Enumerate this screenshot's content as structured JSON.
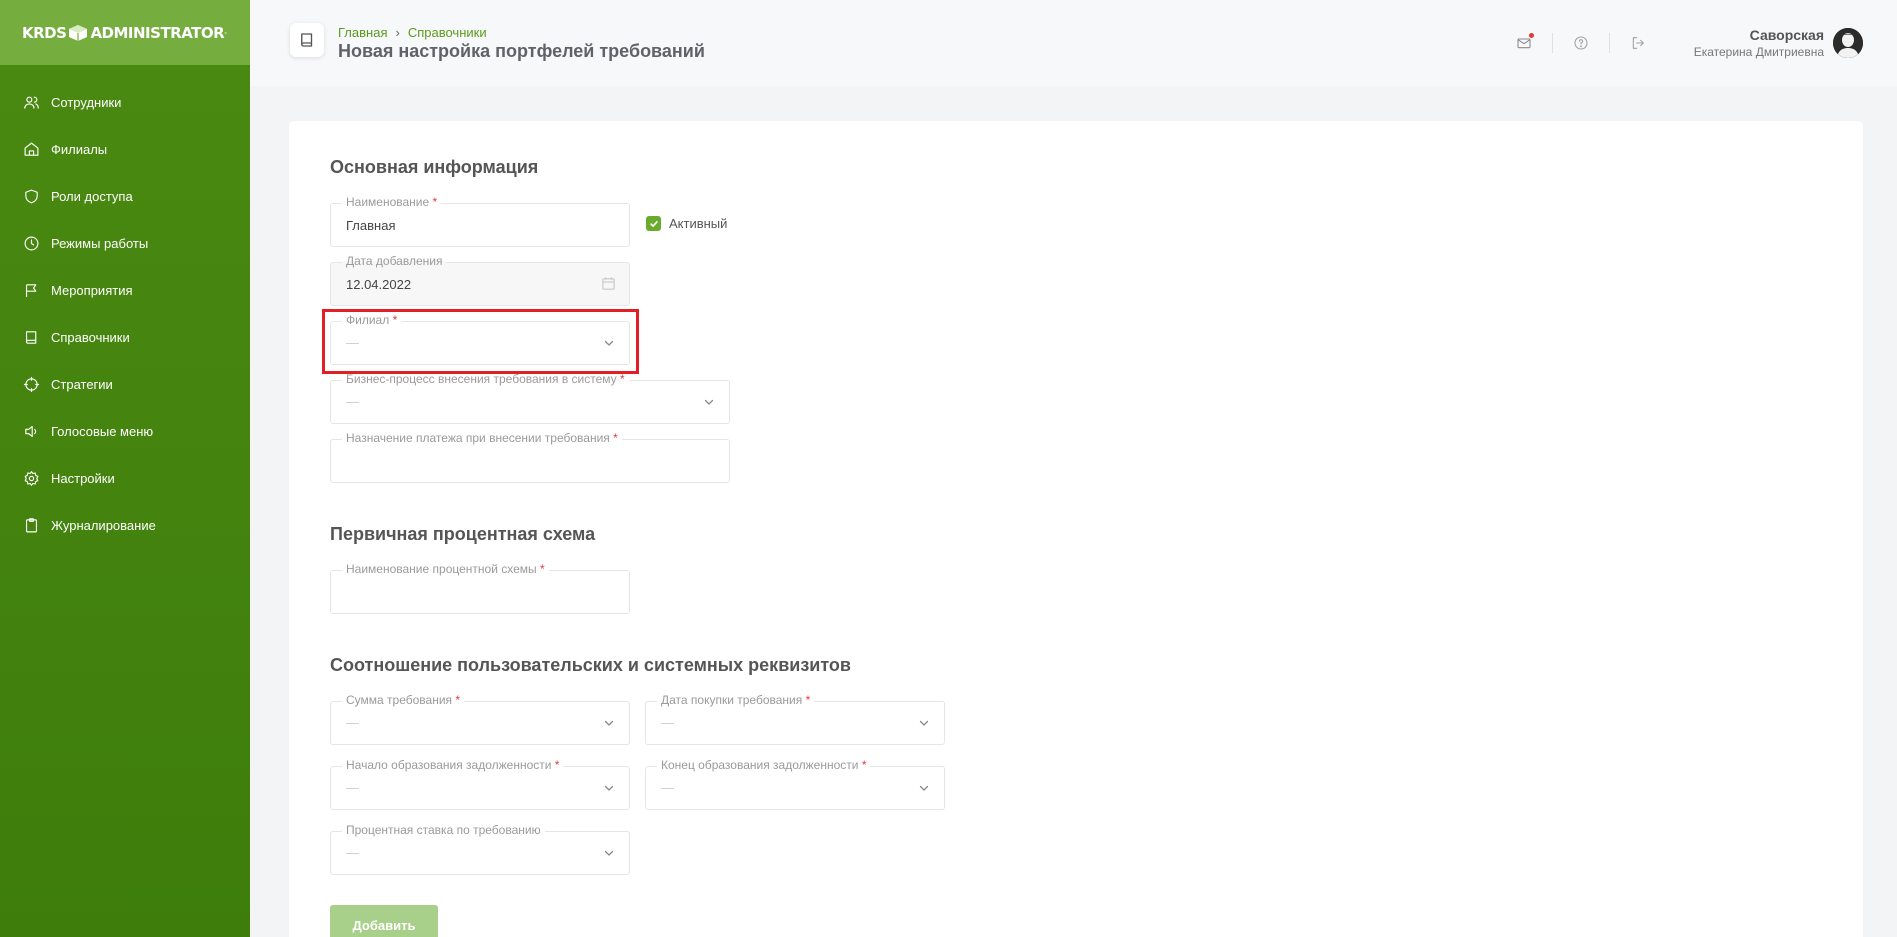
{
  "app": {
    "logo_left": "KRDS",
    "logo_right": "ADMINISTRATOR",
    "accent": "#4a8a12",
    "highlight": "#e31e24"
  },
  "sidebar": {
    "items": [
      {
        "label": "Сотрудники",
        "icon": "users-icon"
      },
      {
        "label": "Филиалы",
        "icon": "home-icon"
      },
      {
        "label": "Роли доступа",
        "icon": "shield-icon"
      },
      {
        "label": "Режимы работы",
        "icon": "clock-icon"
      },
      {
        "label": "Мероприятия",
        "icon": "flag-icon"
      },
      {
        "label": "Справочники",
        "icon": "book-icon"
      },
      {
        "label": "Стратегии",
        "icon": "crosshair-icon"
      },
      {
        "label": "Голосовые меню",
        "icon": "speaker-icon"
      },
      {
        "label": "Настройки",
        "icon": "gear-icon"
      },
      {
        "label": "Журналирование",
        "icon": "clipboard-icon"
      }
    ]
  },
  "header": {
    "breadcrumbs": [
      "Главная",
      "Справочники"
    ],
    "breadcrumb_sep": "›",
    "title": "Новая настройка портфелей требований",
    "user": {
      "surname": "Саворская",
      "given": "Екатерина Дмитриевна"
    }
  },
  "form": {
    "sections": {
      "main": "Основная информация",
      "interest": "Первичная процентная схема",
      "mapping": "Соотношение пользовательских и системных реквизитов"
    },
    "req": "*",
    "placeholder": "—",
    "name": {
      "label": "Наименование",
      "value": "Главная"
    },
    "active": {
      "label": "Активный",
      "checked": true
    },
    "date_added": {
      "label": "Дата добавления",
      "value": "12.04.2022"
    },
    "branch": {
      "label": "Филиал"
    },
    "business_process": {
      "label": "Бизнес-процесс внесения требования в систему"
    },
    "payment_purpose": {
      "label": "Назначение платежа при внесении требования"
    },
    "interest_scheme_name": {
      "label": "Наименование процентной схемы"
    },
    "claim_amount": {
      "label": "Сумма требования"
    },
    "purchase_date": {
      "label": "Дата покупки требования"
    },
    "debt_start": {
      "label": "Начало образования задолженности"
    },
    "debt_end": {
      "label": "Конец образования задолженности"
    },
    "interest_rate": {
      "label": "Процентная ставка по требованию"
    },
    "submit": "Добавить"
  }
}
